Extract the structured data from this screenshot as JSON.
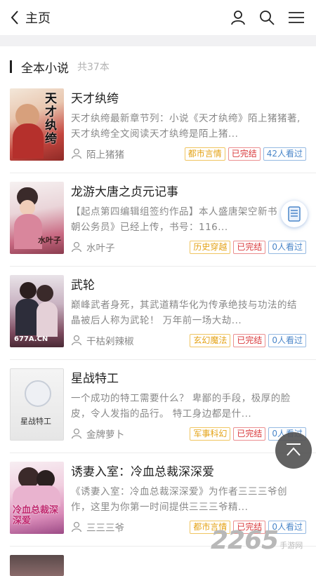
{
  "header": {
    "title": "主页",
    "icons": [
      "back-arrow-icon",
      "user-icon",
      "search-icon",
      "menu-icon"
    ]
  },
  "section": {
    "name": "全本小说",
    "count": "共37本"
  },
  "books": [
    {
      "title": "天才纨绔",
      "desc": "天才纨绔最新章节列：小说《天才纨绔》陌上猪猪著,天才纨绔全文阅读天才纨绔是陌上猪...",
      "author": "陌上猪猪",
      "category": "都市言情",
      "status": "已完结",
      "reads": "42人看过",
      "cover_text": "天才纨绔"
    },
    {
      "title": "龙游大唐之贞元记事",
      "desc": "【起点第四编辑组签约作品】本人盛唐架空新书《唐朝公务员》已经上传，书号：116...",
      "author": "水叶子",
      "category": "历史穿越",
      "status": "已完结",
      "reads": "0人看过",
      "cover_text": "水叶子"
    },
    {
      "title": "武轮",
      "desc": "巅峰武者身死，其武道精华化为传承绝技与功法的结晶被后人称为武轮！ 万年前一场大劫...",
      "author": "干枯剁辣椒",
      "category": "玄幻魔法",
      "status": "已完结",
      "reads": "0人看过",
      "cover_text": "677A.CN"
    },
    {
      "title": "星战特工",
      "desc": "一个成功的特工需要什么？ 卑鄙的手段，极厚的脸皮，令人发指的品行。 特工身边都是什...",
      "author": "金牌萝卜",
      "category": "军事科幻",
      "status": "已完结",
      "reads": "0人看过",
      "cover_text": "星战特工"
    },
    {
      "title": "诱妻入室：冷血总裁深深爱",
      "desc": "《诱妻入室：冷血总裁深深爱》为作者三三三爷创作，这里为你第一时间提供三三三爷精...",
      "author": "三三三爷",
      "category": "都市言情",
      "status": "已完结",
      "reads": "0人看过",
      "cover_text": "冷血总裁深深爱"
    }
  ],
  "colors": {
    "category": "#e4a317",
    "status": "#d9383a",
    "reads": "#4a86c9"
  },
  "watermark": {
    "number": "2265",
    "text": "手游网"
  }
}
